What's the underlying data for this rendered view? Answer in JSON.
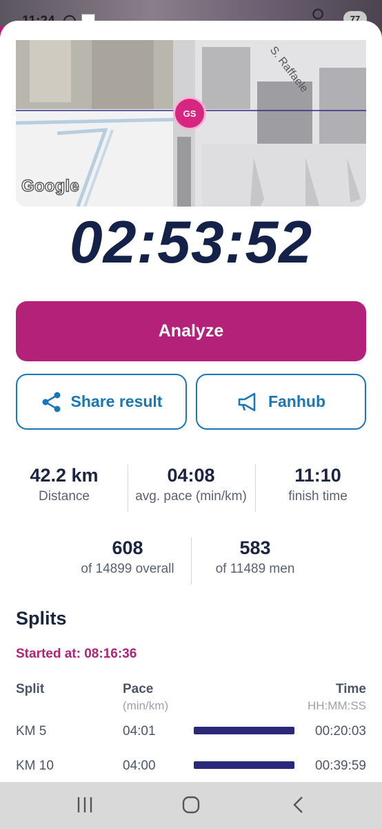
{
  "status_bar": {
    "time": "11:24",
    "notification_count": "77"
  },
  "map": {
    "street_label": "S. Raffaele",
    "marker_label": "GS",
    "attribution": "Google"
  },
  "result": {
    "finish_time": "02:53:52"
  },
  "buttons": {
    "analyze": "Analyze",
    "share": "Share result",
    "fanhub": "Fanhub"
  },
  "stats": {
    "distance_value": "42.2 km",
    "distance_label": "Distance",
    "pace_value": "04:08",
    "pace_label": "avg. pace (min/km)",
    "clock_value": "11:10",
    "clock_label": "finish time",
    "overall_value": "608",
    "overall_label": "of 14899 overall",
    "men_value": "583",
    "men_label": "of 11489 men"
  },
  "splits": {
    "title": "Splits",
    "started_at": "Started at: 08:16:36",
    "headers": {
      "split": "Split",
      "pace": "Pace",
      "pace_unit": "(min/km)",
      "time": "Time",
      "time_unit": "HH:MM:SS"
    },
    "rows": [
      {
        "split": "KM 5",
        "pace": "04:01",
        "time": "00:20:03",
        "bar_fraction": 0.97
      },
      {
        "split": "KM 10",
        "pace": "04:00",
        "time": "00:39:59",
        "bar_fraction": 0.97
      }
    ]
  },
  "colors": {
    "brand": "#b32278",
    "link": "#1976b9",
    "bar": "#2b2879",
    "text": "#1b2440"
  }
}
